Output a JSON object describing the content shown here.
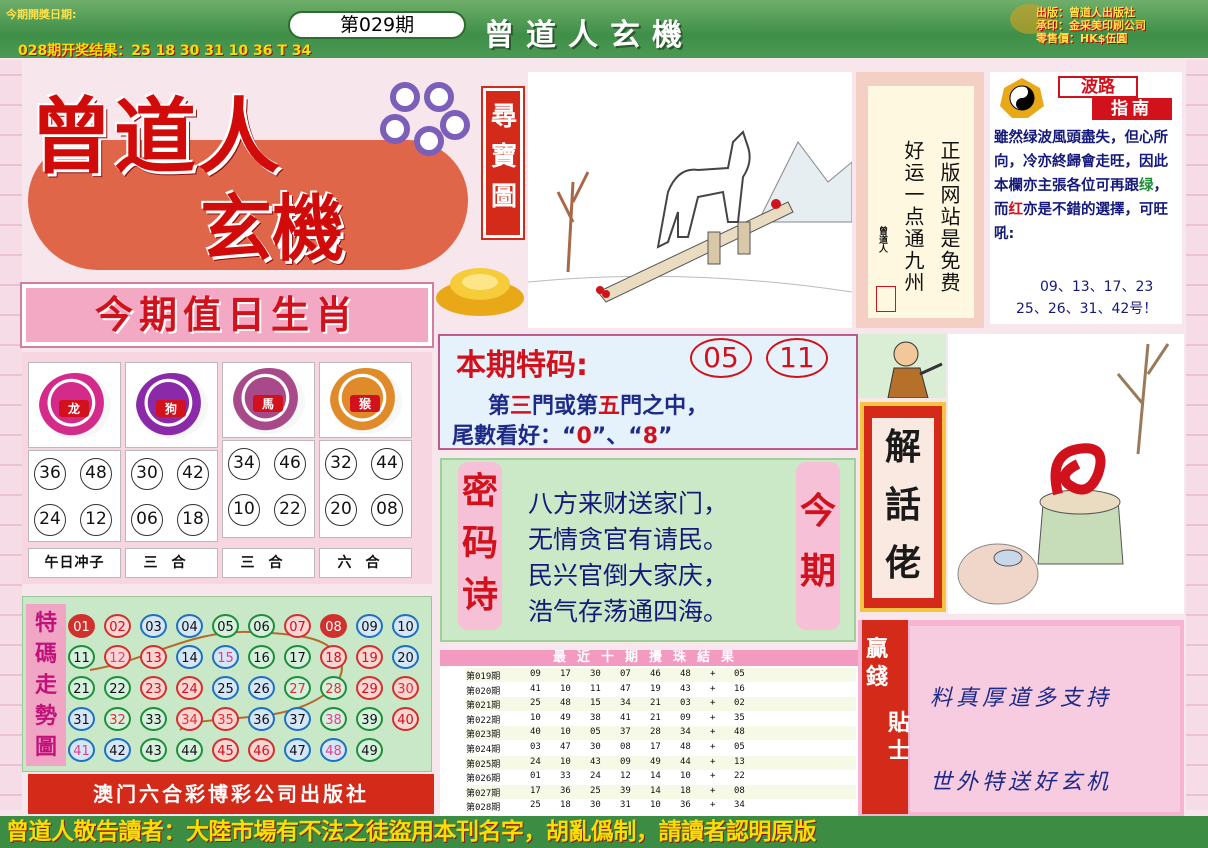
{
  "header": {
    "date_label": "今期開獎日期:",
    "issue": "第029期",
    "last_result": "028期开奖结果：25 18 30 31 10 36 T 34",
    "title": "曾道人玄機",
    "publisher_lines": [
      "出版：曾道人出版社",
      "承印：金采美印刷公司",
      "零售價：HK$伍圓"
    ]
  },
  "logo": {
    "main": "曾道人",
    "sub": "玄機",
    "treasure": "尋寶圖"
  },
  "zodiac": {
    "title": "今期值日生肖",
    "animals": [
      {
        "name": "龙",
        "color": "#d42a8a",
        "numbers": [
          "36",
          "48",
          "24",
          "12"
        ],
        "label": "午日冲子"
      },
      {
        "name": "狗",
        "color": "#8a2aa8",
        "numbers": [
          "30",
          "42",
          "06",
          "18"
        ],
        "label": "三合"
      },
      {
        "name": "馬",
        "color": "#a84a8a",
        "numbers": [
          "34",
          "46",
          "10",
          "22"
        ],
        "label": "三合"
      },
      {
        "name": "猴",
        "color": "#e08a2a",
        "numbers": [
          "32",
          "44",
          "20",
          "08"
        ],
        "label": "六合"
      }
    ]
  },
  "trend": {
    "label": "特碼走勢圖",
    "rows": [
      [
        "01",
        "02",
        "03",
        "04",
        "05",
        "06",
        "07",
        "08",
        "09",
        "10"
      ],
      [
        "11",
        "12",
        "13",
        "14",
        "15",
        "16",
        "17",
        "18",
        "19",
        "20"
      ],
      [
        "21",
        "22",
        "23",
        "24",
        "25",
        "26",
        "27",
        "28",
        "29",
        "30"
      ],
      [
        "31",
        "32",
        "33",
        "34",
        "35",
        "36",
        "37",
        "38",
        "39",
        "40"
      ],
      [
        "41",
        "42",
        "43",
        "44",
        "45",
        "46",
        "47",
        "48",
        "49"
      ]
    ]
  },
  "publisher": "澳门六合彩博彩公司出版社",
  "special": {
    "title": "本期特码:",
    "numbers": [
      "05",
      "11"
    ],
    "line1_a": "第",
    "line1_b": "三",
    "line1_c": "門或第",
    "line1_d": "五",
    "line1_e": "門之中，",
    "line2_a": "尾數看好：“",
    "line2_b": "0",
    "line2_c": "”、“",
    "line2_d": "8",
    "line2_e": "”"
  },
  "poem": {
    "left": "密码诗",
    "right": "今期",
    "lines": [
      "八方来财送家门，",
      "无情贪官有请民。",
      "民兴官倒大家庆，",
      "浩气存荡通四海。"
    ]
  },
  "results": {
    "title": "最近十期攪珠結果",
    "rows": [
      [
        "第019期",
        "09",
        "17",
        "30",
        "07",
        "46",
        "48",
        "+",
        "05"
      ],
      [
        "第020期",
        "41",
        "10",
        "11",
        "47",
        "19",
        "43",
        "+",
        "16"
      ],
      [
        "第021期",
        "25",
        "48",
        "15",
        "34",
        "21",
        "03",
        "+",
        "02"
      ],
      [
        "第022期",
        "10",
        "49",
        "38",
        "41",
        "21",
        "09",
        "+",
        "35"
      ],
      [
        "第023期",
        "40",
        "10",
        "05",
        "37",
        "28",
        "34",
        "+",
        "48"
      ],
      [
        "第024期",
        "03",
        "47",
        "30",
        "08",
        "17",
        "48",
        "+",
        "05"
      ],
      [
        "第025期",
        "24",
        "10",
        "43",
        "09",
        "49",
        "44",
        "+",
        "13"
      ],
      [
        "第026期",
        "01",
        "33",
        "24",
        "12",
        "14",
        "10",
        "+",
        "22"
      ],
      [
        "第027期",
        "17",
        "36",
        "25",
        "39",
        "14",
        "18",
        "+",
        "08"
      ],
      [
        "第028期",
        "25",
        "18",
        "30",
        "31",
        "10",
        "36",
        "+",
        "34"
      ]
    ]
  },
  "motto": {
    "col_right": "正版网站是免费",
    "col_left": "好运一点通九州",
    "small": "曾道人"
  },
  "wave": {
    "title1": "波路",
    "title2": "指南",
    "text_a": "雖然绿波風頭盡失，但心所向，冷亦終歸會走旺，因此本欄亦主張各位可再跟",
    "green_word": "绿",
    "text_b": "，而",
    "red_word": "红",
    "text_c": "亦是不錯的選擇，可旺吼:",
    "nums1": "09、13、17、23",
    "nums2": "25、26、31、42号！"
  },
  "jiehua": "解話佬",
  "tips": {
    "label_a": "贏錢",
    "label_b": "貼士",
    "line1": "料真厚道多支持",
    "line2": "世外特送好玄机"
  },
  "footer": "曾道人敬告讀者：大陸市場有不法之徒盜用本刊名字，胡亂僞制，請讀者認明原版"
}
